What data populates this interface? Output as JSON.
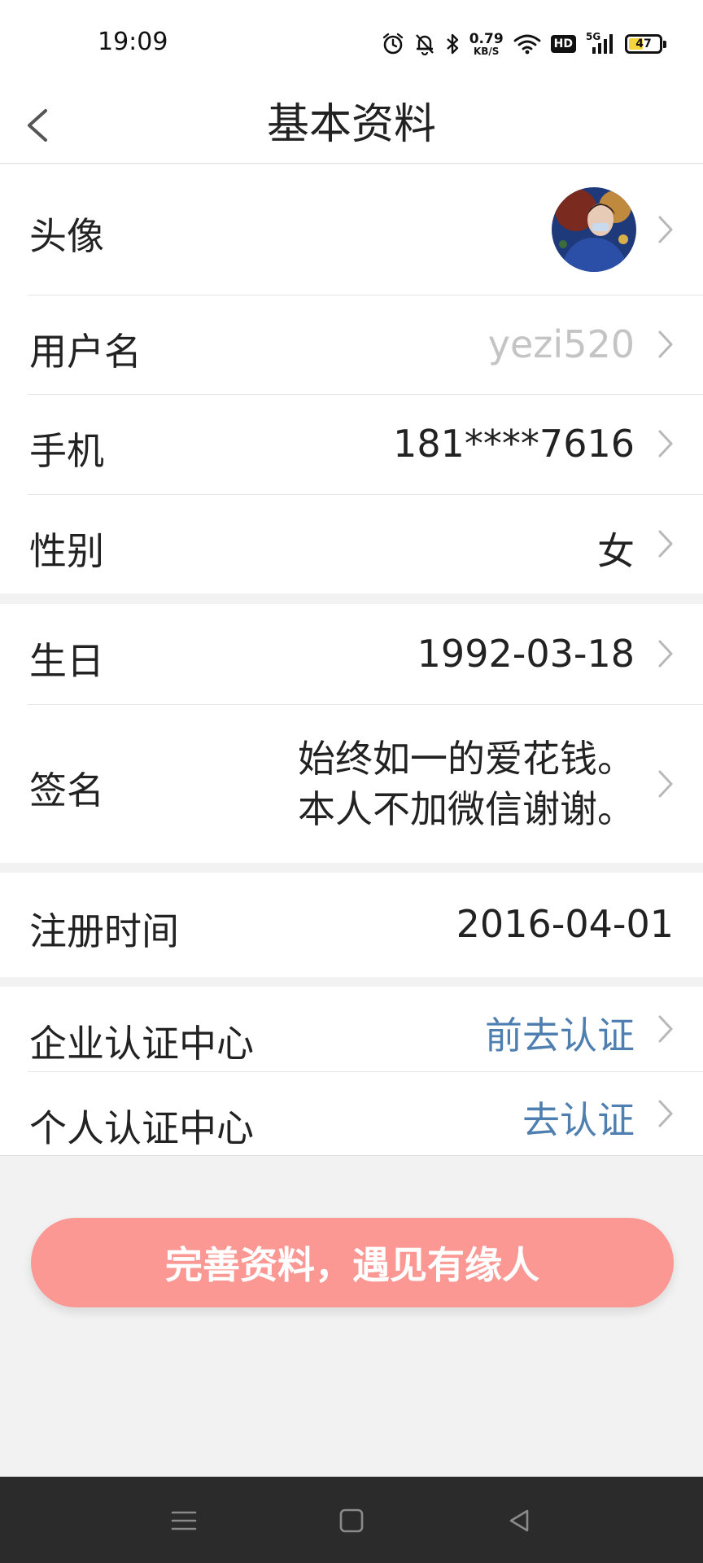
{
  "status_bar": {
    "time": "19:09",
    "net_speed_value": "0.79",
    "net_speed_unit": "KB/S",
    "hd_label": "HD",
    "network_label": "5G",
    "battery_level": "47",
    "battery_fraction": 0.47,
    "icons": [
      "alarm-icon",
      "mute-bell-icon",
      "bluetooth-icon",
      "wifi-icon",
      "signal-icon",
      "battery-icon"
    ]
  },
  "header": {
    "title": "基本资料",
    "back_icon": "chevron-left-icon"
  },
  "profile": {
    "avatar_label": "头像",
    "username_label": "用户名",
    "username_value": "yezi520",
    "phone_label": "手机",
    "phone_value": "181****7616",
    "gender_label": "性别",
    "gender_value": "女",
    "birthday_label": "生日",
    "birthday_value": "1992-03-18",
    "signature_label": "签名",
    "signature_line1": "始终如一的爱花钱。",
    "signature_line2": "本人不加微信谢谢。",
    "register_label": "注册时间",
    "register_value": "2016-04-01",
    "enterprise_label": "企业认证中心",
    "enterprise_action": "前去认证",
    "personal_label": "个人认证中心",
    "personal_action": "去认证"
  },
  "cta": {
    "label": "完善资料，遇见有缘人"
  },
  "nav_bar": {
    "icons": [
      "menu-icon",
      "home-square-icon",
      "back-triangle-icon"
    ]
  },
  "colors": {
    "accent_button": "#fc9894",
    "link_blue": "#4e7fb0",
    "muted_text": "#c4c4c4",
    "battery_fill": "#f5d33d"
  }
}
